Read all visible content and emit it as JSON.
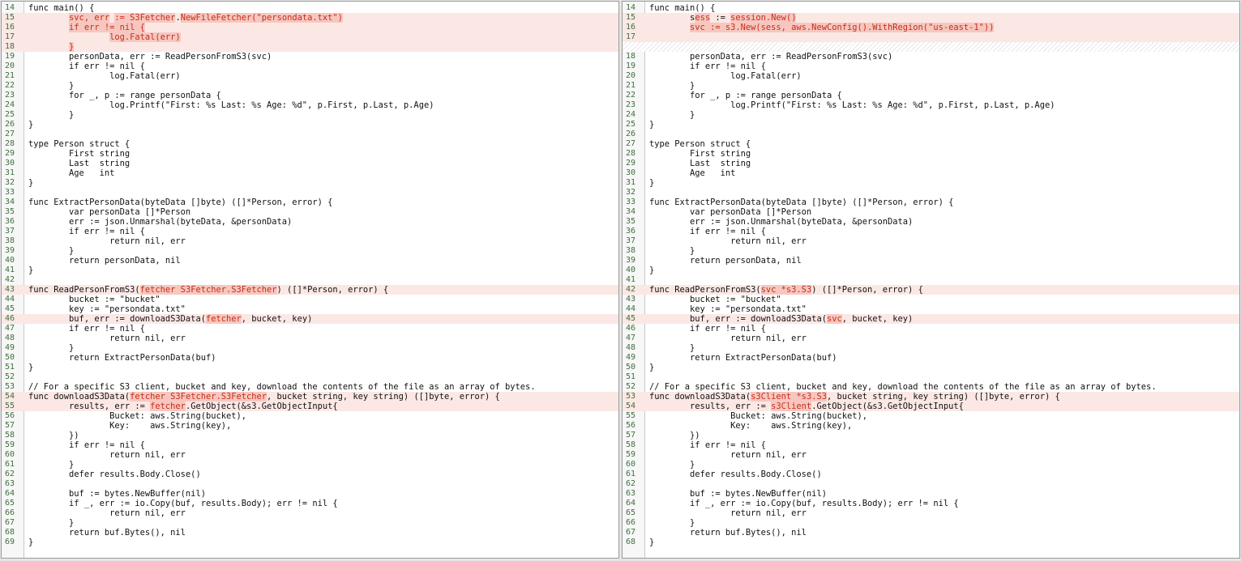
{
  "colors": {
    "changed_line_bg": "#fbe8e5",
    "changed_token_bg": "#f7c7bf",
    "changed_token_fg": "#c62d1b",
    "line_number_fg": "#3f6f3f"
  },
  "left_pane": {
    "lines": [
      {
        "n": "14",
        "code": "func main() {"
      },
      {
        "n": "15",
        "code": "        svc, err := S3Fetcher.NewFileFetcher(\"persondata.txt\")",
        "changed": true,
        "hl": [
          "svc, err",
          ":= ",
          "S3Fetcher",
          "NewFileFetcher(\"persondata.txt\")"
        ]
      },
      {
        "n": "16",
        "code": "        if err != nil {",
        "changed": true,
        "hl": [
          "if err != nil {"
        ]
      },
      {
        "n": "17",
        "code": "                log.Fatal(err)",
        "changed": true,
        "hl": [
          "log.Fatal(err)"
        ]
      },
      {
        "n": "18",
        "code": "        }",
        "changed": true,
        "hl": [
          "}"
        ]
      },
      {
        "n": "19",
        "code": "        personData, err := ReadPersonFromS3(svc)"
      },
      {
        "n": "20",
        "code": "        if err != nil {"
      },
      {
        "n": "21",
        "code": "                log.Fatal(err)"
      },
      {
        "n": "22",
        "code": "        }"
      },
      {
        "n": "23",
        "code": "        for _, p := range personData {"
      },
      {
        "n": "24",
        "code": "                log.Printf(\"First: %s Last: %s Age: %d\", p.First, p.Last, p.Age)"
      },
      {
        "n": "25",
        "code": "        }"
      },
      {
        "n": "26",
        "code": "}"
      },
      {
        "n": "27",
        "code": ""
      },
      {
        "n": "28",
        "code": "type Person struct {"
      },
      {
        "n": "29",
        "code": "        First string"
      },
      {
        "n": "30",
        "code": "        Last  string"
      },
      {
        "n": "31",
        "code": "        Age   int"
      },
      {
        "n": "32",
        "code": "}"
      },
      {
        "n": "33",
        "code": ""
      },
      {
        "n": "34",
        "code": "func ExtractPersonData(byteData []byte) ([]*Person, error) {"
      },
      {
        "n": "35",
        "code": "        var personData []*Person"
      },
      {
        "n": "36",
        "code": "        err := json.Unmarshal(byteData, &personData)"
      },
      {
        "n": "37",
        "code": "        if err != nil {"
      },
      {
        "n": "38",
        "code": "                return nil, err"
      },
      {
        "n": "39",
        "code": "        }"
      },
      {
        "n": "40",
        "code": "        return personData, nil"
      },
      {
        "n": "41",
        "code": "}"
      },
      {
        "n": "42",
        "code": ""
      },
      {
        "n": "43",
        "code": "func ReadPersonFromS3(fetcher S3Fetcher.S3Fetcher) ([]*Person, error) {",
        "changed": true,
        "hl": [
          "fetcher S3Fetcher.S3Fetcher"
        ]
      },
      {
        "n": "44",
        "code": "        bucket := \"bucket\""
      },
      {
        "n": "45",
        "code": "        key := \"persondata.txt\""
      },
      {
        "n": "46",
        "code": "        buf, err := downloadS3Data(fetcher, bucket, key)",
        "changed": true,
        "hl": [
          "fetcher"
        ]
      },
      {
        "n": "47",
        "code": "        if err != nil {"
      },
      {
        "n": "48",
        "code": "                return nil, err"
      },
      {
        "n": "49",
        "code": "        }"
      },
      {
        "n": "50",
        "code": "        return ExtractPersonData(buf)"
      },
      {
        "n": "51",
        "code": "}"
      },
      {
        "n": "52",
        "code": ""
      },
      {
        "n": "53",
        "code": "// For a specific S3 client, bucket and key, download the contents of the file as an array of bytes."
      },
      {
        "n": "54",
        "code": "func downloadS3Data(fetcher S3Fetcher.S3Fetcher, bucket string, key string) ([]byte, error) {",
        "changed": true,
        "hl": [
          "fetcher S3Fetcher.S3Fetcher"
        ]
      },
      {
        "n": "55",
        "code": "        results, err := fetcher.GetObject(&s3.GetObjectInput{",
        "changed": true,
        "hl": [
          "fetcher"
        ]
      },
      {
        "n": "56",
        "code": "                Bucket: aws.String(bucket),"
      },
      {
        "n": "57",
        "code": "                Key:    aws.String(key),"
      },
      {
        "n": "58",
        "code": "        })"
      },
      {
        "n": "59",
        "code": "        if err != nil {"
      },
      {
        "n": "60",
        "code": "                return nil, err"
      },
      {
        "n": "61",
        "code": "        }"
      },
      {
        "n": "62",
        "code": "        defer results.Body.Close()"
      },
      {
        "n": "63",
        "code": ""
      },
      {
        "n": "64",
        "code": "        buf := bytes.NewBuffer(nil)"
      },
      {
        "n": "65",
        "code": "        if _, err := io.Copy(buf, results.Body); err != nil {"
      },
      {
        "n": "66",
        "code": "                return nil, err"
      },
      {
        "n": "67",
        "code": "        }"
      },
      {
        "n": "68",
        "code": "        return buf.Bytes(), nil"
      },
      {
        "n": "69",
        "code": "}"
      }
    ]
  },
  "right_pane": {
    "lines": [
      {
        "n": "14",
        "code": "func main() {"
      },
      {
        "n": "15",
        "code": "        sess := session.New()",
        "changed": true,
        "hl": [
          "ess",
          "session.New()"
        ]
      },
      {
        "n": "16",
        "code": "        svc := s3.New(sess, aws.NewConfig().WithRegion(\"us-east-1\"))",
        "changed": true,
        "hl": [
          "svc := s3.New(sess, aws.NewConfig().WithRegion(\"us-east-1\"))"
        ]
      },
      {
        "n": "17",
        "code": "",
        "changed": true
      },
      {
        "n": "",
        "code": "",
        "filler": true
      },
      {
        "n": "18",
        "code": "        personData, err := ReadPersonFromS3(svc)"
      },
      {
        "n": "19",
        "code": "        if err != nil {"
      },
      {
        "n": "20",
        "code": "                log.Fatal(err)"
      },
      {
        "n": "21",
        "code": "        }"
      },
      {
        "n": "22",
        "code": "        for _, p := range personData {"
      },
      {
        "n": "23",
        "code": "                log.Printf(\"First: %s Last: %s Age: %d\", p.First, p.Last, p.Age)"
      },
      {
        "n": "24",
        "code": "        }"
      },
      {
        "n": "25",
        "code": "}"
      },
      {
        "n": "26",
        "code": ""
      },
      {
        "n": "27",
        "code": "type Person struct {"
      },
      {
        "n": "28",
        "code": "        First string"
      },
      {
        "n": "29",
        "code": "        Last  string"
      },
      {
        "n": "30",
        "code": "        Age   int"
      },
      {
        "n": "31",
        "code": "}"
      },
      {
        "n": "32",
        "code": ""
      },
      {
        "n": "33",
        "code": "func ExtractPersonData(byteData []byte) ([]*Person, error) {"
      },
      {
        "n": "34",
        "code": "        var personData []*Person"
      },
      {
        "n": "35",
        "code": "        err := json.Unmarshal(byteData, &personData)"
      },
      {
        "n": "36",
        "code": "        if err != nil {"
      },
      {
        "n": "37",
        "code": "                return nil, err"
      },
      {
        "n": "38",
        "code": "        }"
      },
      {
        "n": "39",
        "code": "        return personData, nil"
      },
      {
        "n": "40",
        "code": "}"
      },
      {
        "n": "41",
        "code": ""
      },
      {
        "n": "42",
        "code": "func ReadPersonFromS3(svc *s3.S3) ([]*Person, error) {",
        "changed": true,
        "hl": [
          "svc *s3.S3"
        ]
      },
      {
        "n": "43",
        "code": "        bucket := \"bucket\""
      },
      {
        "n": "44",
        "code": "        key := \"persondata.txt\""
      },
      {
        "n": "45",
        "code": "        buf, err := downloadS3Data(svc, bucket, key)",
        "changed": true,
        "hl": [
          "svc"
        ]
      },
      {
        "n": "46",
        "code": "        if err != nil {"
      },
      {
        "n": "47",
        "code": "                return nil, err"
      },
      {
        "n": "48",
        "code": "        }"
      },
      {
        "n": "49",
        "code": "        return ExtractPersonData(buf)"
      },
      {
        "n": "50",
        "code": "}"
      },
      {
        "n": "51",
        "code": ""
      },
      {
        "n": "52",
        "code": "// For a specific S3 client, bucket and key, download the contents of the file as an array of bytes."
      },
      {
        "n": "53",
        "code": "func downloadS3Data(s3Client *s3.S3, bucket string, key string) ([]byte, error) {",
        "changed": true,
        "hl": [
          "s3Client *s3.S3"
        ]
      },
      {
        "n": "54",
        "code": "        results, err := s3Client.GetObject(&s3.GetObjectInput{",
        "changed": true,
        "hl": [
          "s3Client"
        ]
      },
      {
        "n": "55",
        "code": "                Bucket: aws.String(bucket),"
      },
      {
        "n": "56",
        "code": "                Key:    aws.String(key),"
      },
      {
        "n": "57",
        "code": "        })"
      },
      {
        "n": "58",
        "code": "        if err != nil {"
      },
      {
        "n": "59",
        "code": "                return nil, err"
      },
      {
        "n": "60",
        "code": "        }"
      },
      {
        "n": "61",
        "code": "        defer results.Body.Close()"
      },
      {
        "n": "62",
        "code": ""
      },
      {
        "n": "63",
        "code": "        buf := bytes.NewBuffer(nil)"
      },
      {
        "n": "64",
        "code": "        if _, err := io.Copy(buf, results.Body); err != nil {"
      },
      {
        "n": "65",
        "code": "                return nil, err"
      },
      {
        "n": "66",
        "code": "        }"
      },
      {
        "n": "67",
        "code": "        return buf.Bytes(), nil"
      },
      {
        "n": "68",
        "code": "}"
      }
    ]
  }
}
